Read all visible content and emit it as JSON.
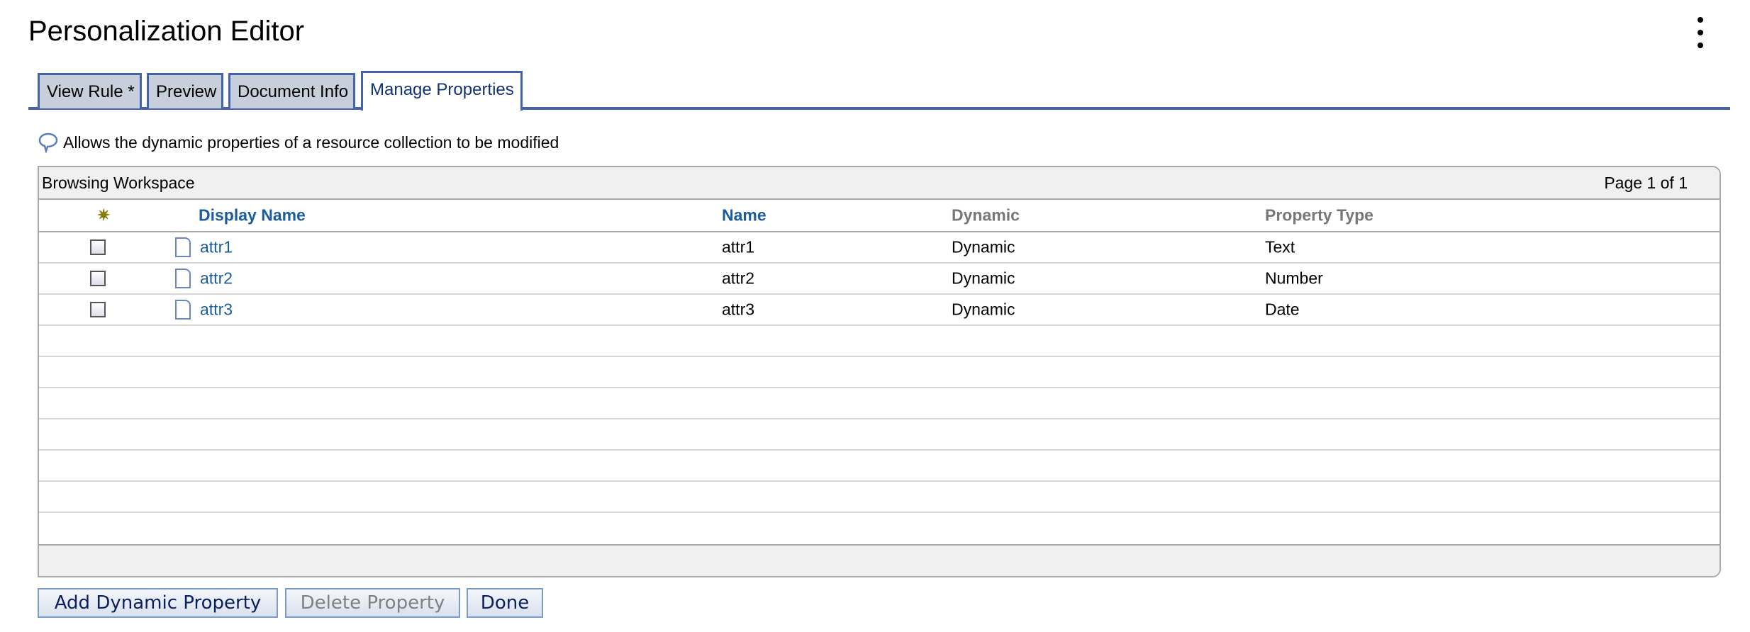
{
  "header": {
    "title": "Personalization Editor",
    "menu_icon": "kebab-menu-icon"
  },
  "tabs": [
    {
      "label": "View Rule *",
      "active": false
    },
    {
      "label": "Preview",
      "active": false
    },
    {
      "label": "Document Info",
      "active": false
    },
    {
      "label": "Manage Properties",
      "active": true
    }
  ],
  "info": {
    "icon": "speech-bubble-icon",
    "text": "Allows the dynamic properties of a resource collection to be modified"
  },
  "table": {
    "title": "Browsing Workspace",
    "page": "Page 1 of 1",
    "columns": [
      "Display Name",
      "Name",
      "Dynamic",
      "Property Type"
    ],
    "rows": [
      {
        "display_name": "attr1",
        "name": "attr1",
        "dynamic": "Dynamic",
        "type": "Text"
      },
      {
        "display_name": "attr2",
        "name": "attr2",
        "dynamic": "Dynamic",
        "type": "Number"
      },
      {
        "display_name": "attr3",
        "name": "attr3",
        "dynamic": "Dynamic",
        "type": "Date"
      }
    ]
  },
  "buttons": {
    "add": "Add Dynamic Property",
    "delete": "Delete Property",
    "done": "Done"
  },
  "colors": {
    "accent": "#4463a8",
    "link": "#1b5d9c"
  }
}
